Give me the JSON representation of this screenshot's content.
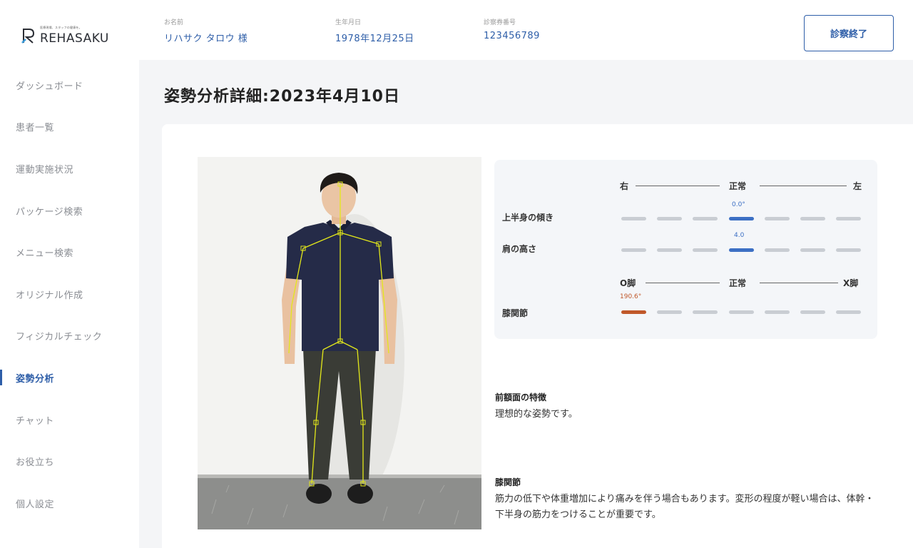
{
  "logo": {
    "text": "REHASAKU",
    "tagline": "医療現場、スタッフの健康を。"
  },
  "nav": {
    "items": [
      {
        "label": "ダッシュボード",
        "active": false
      },
      {
        "label": "患者一覧",
        "active": false
      },
      {
        "label": "運動実施状況",
        "active": false
      },
      {
        "label": "パッケージ検索",
        "active": false
      },
      {
        "label": "メニュー検索",
        "active": false
      },
      {
        "label": "オリジナル作成",
        "active": false
      },
      {
        "label": "フィジカルチェック",
        "active": false
      },
      {
        "label": "姿勢分析",
        "active": true
      },
      {
        "label": "チャット",
        "active": false
      },
      {
        "label": "お役立ち",
        "active": false
      },
      {
        "label": "個人設定",
        "active": false
      }
    ]
  },
  "header": {
    "name_label": "お名前",
    "name_value": "リハサク タロウ 様",
    "birth_label": "生年月日",
    "birth_value": "1978年12月25日",
    "ticket_label": "診察券番号",
    "ticket_value": "123456789",
    "end_button": "診察終了"
  },
  "page": {
    "title": "姿勢分析詳細:2023年4月10日"
  },
  "metrics": {
    "scale1": {
      "left": "右",
      "center": "正常",
      "right": "左"
    },
    "scale2": {
      "left": "O脚",
      "center": "正常",
      "right": "X脚"
    },
    "rows": [
      {
        "label": "上半身の傾き",
        "value": "0.0°",
        "active_index": 3,
        "color": "#3c6fc4"
      },
      {
        "label": "肩の高さ",
        "value": "4.0",
        "active_index": 3,
        "color": "#3c6fc4"
      },
      {
        "label": "膝関節",
        "value": "190.6°",
        "active_index": 0,
        "color": "#c0582a"
      }
    ]
  },
  "notes": {
    "frontal_title": "前額面の特徴",
    "frontal_text": "理想的な姿勢です。",
    "knee_title": "膝関節",
    "knee_text": "筋力の低下や体重増加により痛みを伴う場合もあります。変形の程度が軽い場合は、体幹・下半身の筋力をつけることが重要です。"
  },
  "colors": {
    "accent": "#2e5ea8",
    "bar_active": "#3c6fc4",
    "bar_warning": "#c0582a",
    "bar_inactive": "#c9cdd3",
    "skeleton": "#e3e81a"
  }
}
